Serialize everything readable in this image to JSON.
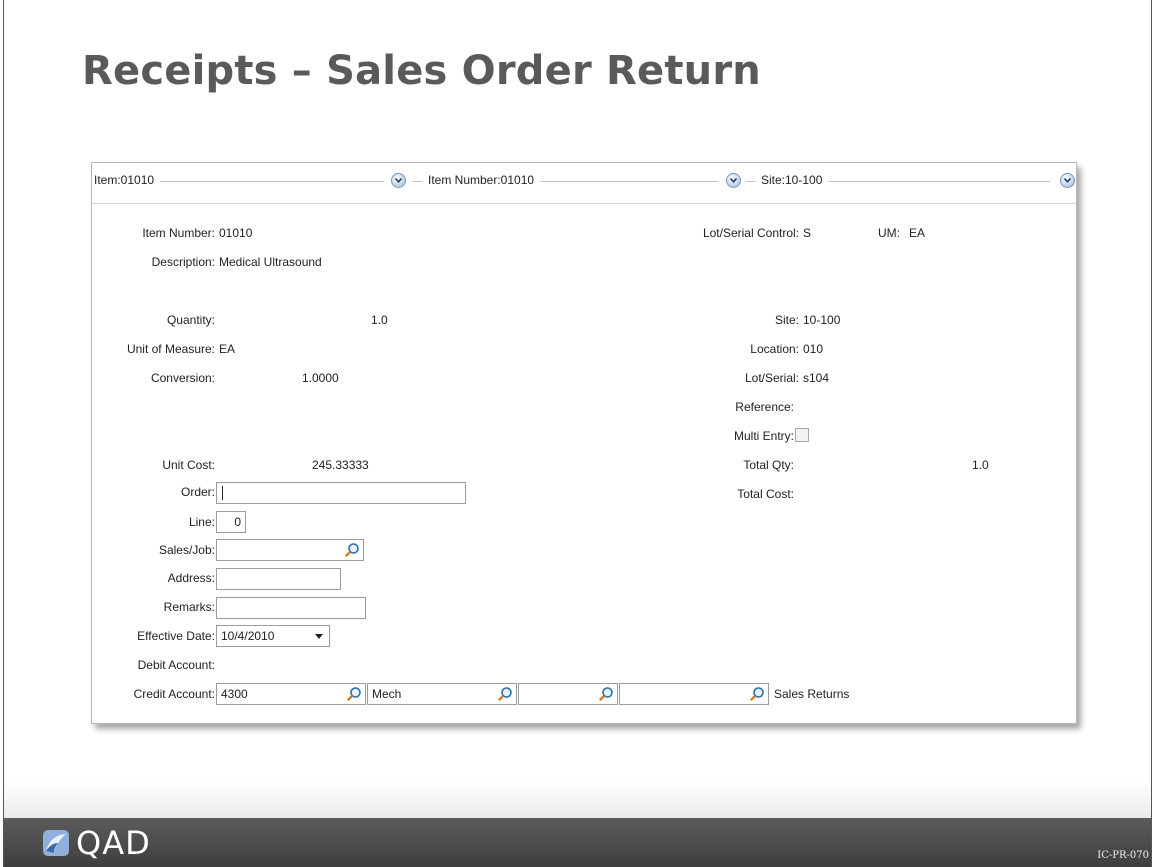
{
  "slide": {
    "title": "Receipts – Sales Order Return",
    "code": "IC-PR-070",
    "logo_text": "QAD"
  },
  "header": {
    "item": "Item:01010",
    "item_number": "Item Number:01010",
    "site": "Site:10-100"
  },
  "form": {
    "item_number_label": "Item Number:",
    "item_number_value": "01010",
    "description_label": "Description:",
    "description_value": "Medical Ultrasound",
    "lot_serial_control_label": "Lot/Serial Control:",
    "lot_serial_control_value": "S",
    "um_label": "UM:",
    "um_value": "EA",
    "quantity_label": "Quantity:",
    "quantity_value": "1.0",
    "uom_label": "Unit of Measure:",
    "uom_value": "EA",
    "conversion_label": "Conversion:",
    "conversion_value": "1.0000",
    "site_label": "Site:",
    "site_value": "10-100",
    "location_label": "Location:",
    "location_value": "010",
    "lot_serial_label": "Lot/Serial:",
    "lot_serial_value": "s104",
    "reference_label": "Reference:",
    "multi_entry_label": "Multi Entry:",
    "unit_cost_label": "Unit Cost:",
    "unit_cost_value": "245.33333",
    "total_qty_label": "Total Qty:",
    "total_qty_value": "1.0",
    "total_cost_label": "Total Cost:",
    "order_label": "Order:",
    "order_value": "",
    "line_label": "Line:",
    "line_value": "0",
    "sales_job_label": "Sales/Job:",
    "sales_job_value": "",
    "address_label": "Address:",
    "address_value": "",
    "remarks_label": "Remarks:",
    "remarks_value": "",
    "effective_date_label": "Effective Date:",
    "effective_date_value": "10/4/2010",
    "debit_account_label": "Debit Account:",
    "credit_account_label": "Credit Account:",
    "credit_account_value": "4300",
    "credit_sub_value": "Mech",
    "credit_cc_value": "",
    "credit_project_value": "",
    "credit_account_desc": "Sales Returns"
  },
  "icons": [
    "chevron-down-icon",
    "search-icon",
    "dropdown-arrow-icon",
    "qad-logo-icon"
  ],
  "colors": {
    "title": "#5a5a5a",
    "footer": "#4a4a4a",
    "chevron": "#b9cde6"
  }
}
